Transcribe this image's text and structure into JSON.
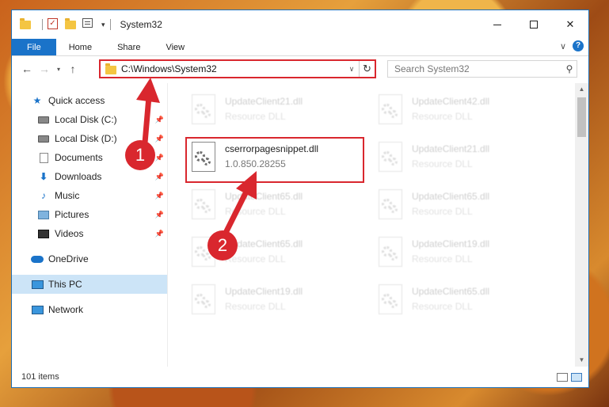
{
  "titlebar": {
    "title": "System32"
  },
  "ribbon": {
    "tabs": [
      "File",
      "Home",
      "Share",
      "View"
    ],
    "help": "?"
  },
  "address": {
    "path": "C:\\Windows\\System32",
    "refresh": "↻"
  },
  "search": {
    "placeholder": "Search System32"
  },
  "navpane": {
    "items": [
      {
        "label": "Quick access",
        "pinned": false
      },
      {
        "label": "Local Disk (C:)",
        "pinned": true
      },
      {
        "label": "Local Disk (D:)",
        "pinned": true
      },
      {
        "label": "Documents",
        "pinned": true
      },
      {
        "label": "Downloads",
        "pinned": true
      },
      {
        "label": "Music",
        "pinned": true
      },
      {
        "label": "Pictures",
        "pinned": true
      },
      {
        "label": "Videos",
        "pinned": true
      },
      {
        "label": "OneDrive",
        "pinned": false
      },
      {
        "label": "This PC",
        "pinned": false,
        "selected": true
      },
      {
        "label": "Network",
        "pinned": false
      }
    ]
  },
  "files": [
    {
      "name": "UpdateClient21.dll",
      "sub": "Resource DLL"
    },
    {
      "name": "UpdateClient42.dll",
      "sub": "Resource DLL"
    },
    {
      "name": "cserrorpagesnippet.dll",
      "sub": "1.0.850.28255",
      "highlighted": true
    },
    {
      "name": "UpdateClient21.dll",
      "sub": "Resource DLL"
    },
    {
      "name": "UpdateClient65.dll",
      "sub": "Resource DLL"
    },
    {
      "name": "UpdateClient65.dll",
      "sub": "Resource DLL"
    },
    {
      "name": "UpdateClient65.dll",
      "sub": "Resource DLL"
    },
    {
      "name": "UpdateClient19.dll",
      "sub": "Resource DLL"
    },
    {
      "name": "UpdateClient19.dll",
      "sub": "Resource DLL"
    },
    {
      "name": "UpdateClient65.dll",
      "sub": "Resource DLL"
    }
  ],
  "status": {
    "item_count": "101 items"
  },
  "annotations": {
    "step1": "1",
    "step2": "2"
  },
  "colors": {
    "accent": "#1a73c9",
    "highlight": "#d9272e",
    "selected": "#cce4f7"
  }
}
